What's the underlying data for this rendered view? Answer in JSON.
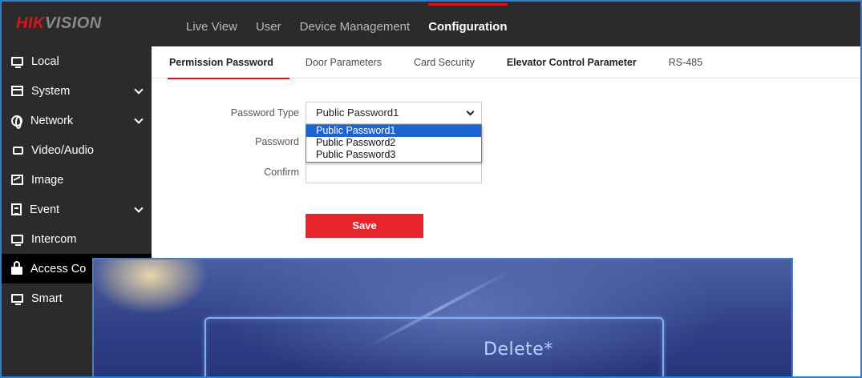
{
  "brand": {
    "hik": "HIK",
    "vision": "VISION"
  },
  "topnav": [
    {
      "label": "Live View",
      "active": false
    },
    {
      "label": "User",
      "active": false
    },
    {
      "label": "Device Management",
      "active": false
    },
    {
      "label": "Configuration",
      "active": true
    }
  ],
  "sidebar": {
    "items": [
      {
        "label": "Local",
        "icon": "monitor-icon"
      },
      {
        "label": "System",
        "icon": "window-icon",
        "expandable": true
      },
      {
        "label": "Network",
        "icon": "globe-icon",
        "expandable": true
      },
      {
        "label": "Video/Audio",
        "icon": "video-icon"
      },
      {
        "label": "Image",
        "icon": "image-icon"
      },
      {
        "label": "Event",
        "icon": "document-icon",
        "expandable": true
      },
      {
        "label": "Intercom",
        "icon": "monitor-icon"
      },
      {
        "label": "Access Co",
        "icon": "lock-icon",
        "active": true
      },
      {
        "label": "Smart",
        "icon": "monitor-icon"
      }
    ]
  },
  "subtabs": [
    {
      "label": "Permission Password",
      "active": true,
      "bold": true
    },
    {
      "label": "Door Parameters"
    },
    {
      "label": "Card Security"
    },
    {
      "label": "Elevator Control Parameter",
      "bold": true
    },
    {
      "label": "RS-485"
    }
  ],
  "form": {
    "password_type_label": "Password Type",
    "password_type_value": "Public Password1",
    "options": [
      "Public Password1",
      "Public Password2",
      "Public Password3"
    ],
    "password_label": "Password",
    "confirm_label": "Confirm",
    "save_label": "Save"
  },
  "photo": {
    "button_text": "Delete*"
  },
  "colors": {
    "accent": "#d7141a",
    "save": "#e8242b",
    "selection": "#1c64d2",
    "topbar": "#2b2b2b"
  }
}
